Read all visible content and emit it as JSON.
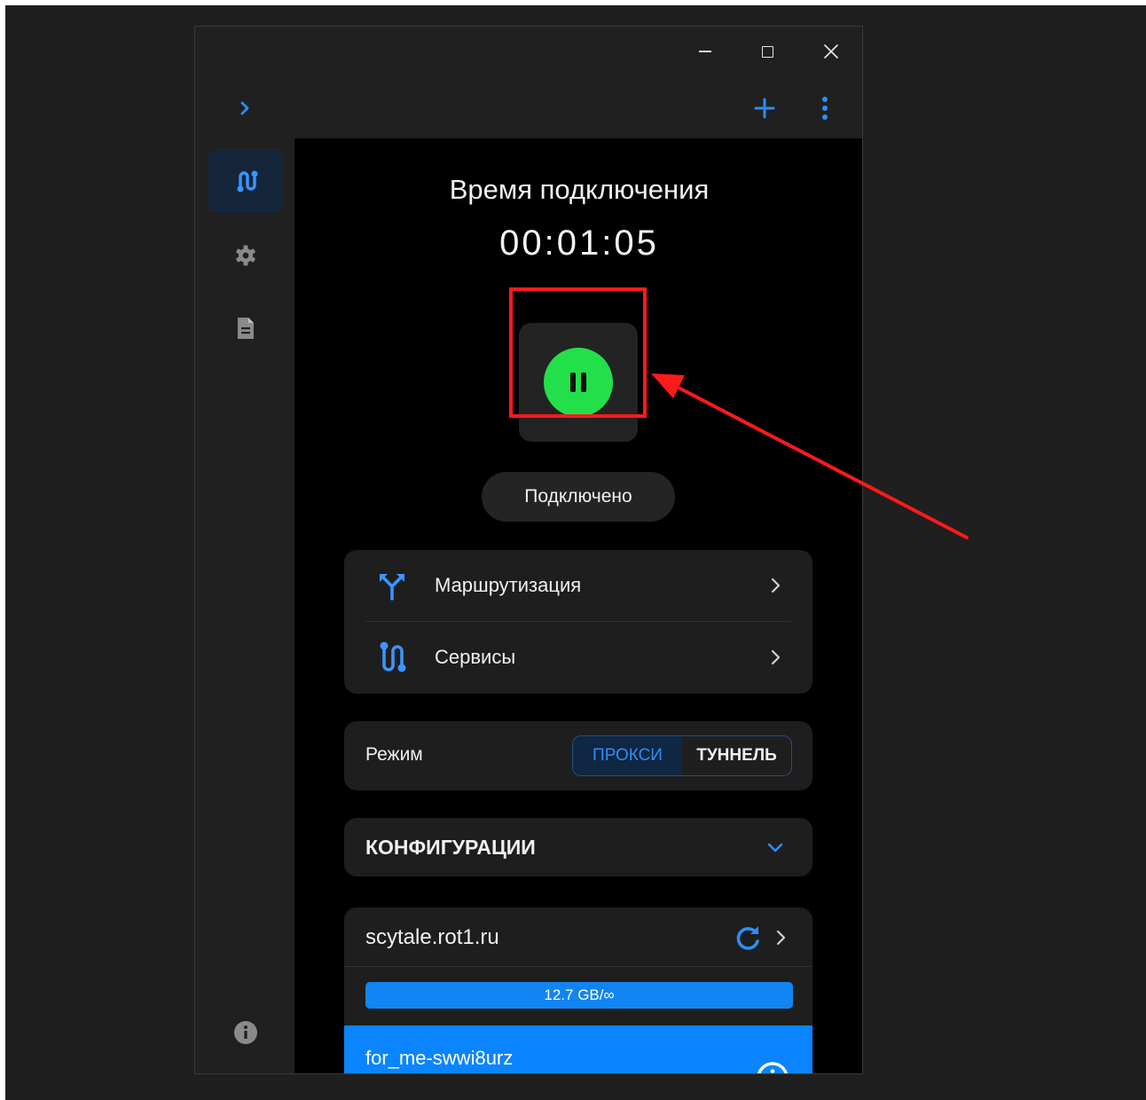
{
  "window": {
    "controls": {
      "minimize_icon": "minimize-icon",
      "maximize_icon": "maximize-icon",
      "close_icon": "close-icon"
    }
  },
  "toolbar": {
    "expand_icon": "chevron-right-icon",
    "add_icon": "plus-icon",
    "more_icon": "more-vertical-icon"
  },
  "sidebar": {
    "items": [
      {
        "icon": "route-icon",
        "active": true
      },
      {
        "icon": "gear-icon",
        "active": false
      },
      {
        "icon": "document-icon",
        "active": false
      },
      {
        "icon": "info-icon",
        "active": false
      }
    ]
  },
  "connection": {
    "title": "Время подключения",
    "timer": "00:01:05",
    "toggle_icon": "pause-icon",
    "status": "Подключено"
  },
  "nav_card": {
    "items": [
      {
        "label": "Маршрутизация",
        "icon": "fork-icon"
      },
      {
        "label": "Сервисы",
        "icon": "route-icon"
      }
    ]
  },
  "mode": {
    "label": "Режим",
    "options": [
      "ПРОКСИ",
      "ТУННЕЛЬ"
    ],
    "selected": "ПРОКСИ"
  },
  "configs": {
    "title": "КОНФИГУРАЦИИ",
    "toggle_icon": "chevron-down-icon"
  },
  "server": {
    "name": "scytale.rot1.ru",
    "refresh_icon": "refresh-icon",
    "traffic_text": "12.7 GB/∞",
    "traffic_fraction": 1.0,
    "profile_name": "for_me-swwi8urz",
    "profile_info_icon": "info-icon"
  },
  "colors": {
    "accent": "#0a84ff",
    "connected": "#22e04a",
    "annotation": "#ff1a1a"
  }
}
